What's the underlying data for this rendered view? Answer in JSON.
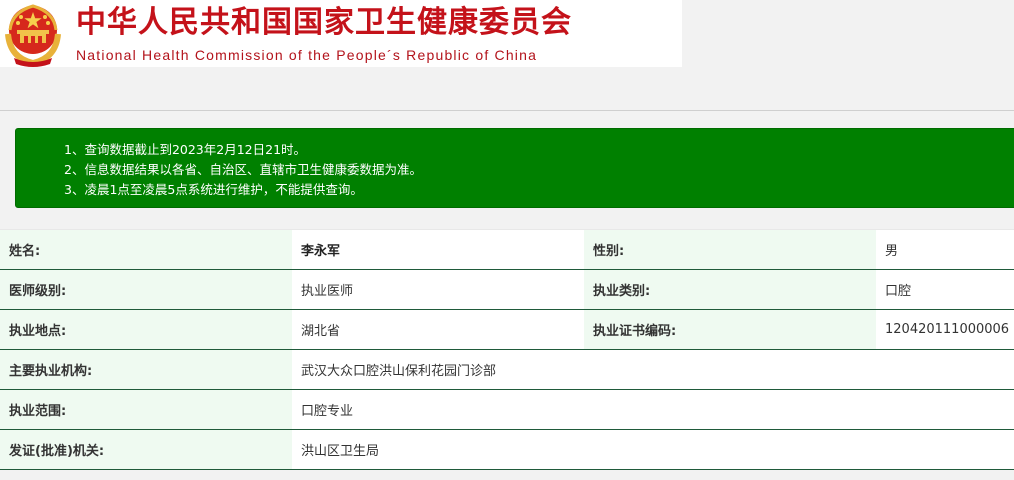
{
  "header": {
    "title_cn": "中华人民共和国国家卫生健康委员会",
    "title_en": "National Health Commission of the People´s Republic of China",
    "emblem_icon": "national-emblem-icon",
    "title_color": "#c4121a"
  },
  "notice": {
    "background": "#008000",
    "lines": [
      "1、查询数据截止到2023年2月12日21时。",
      "2、信息数据结果以各省、自治区、直辖市卫生健康委数据为准。",
      "3、凌晨1点至凌晨5点系统进行维护，不能提供查询。"
    ]
  },
  "record": {
    "name_label": "姓名:",
    "name_value": "李永军",
    "gender_label": "性别:",
    "gender_value": "男",
    "level_label": "医师级别:",
    "level_value": "执业医师",
    "category_label": "执业类别:",
    "category_value": "口腔",
    "location_label": "执业地点:",
    "location_value": "湖北省",
    "cert_label": "执业证书编码:",
    "cert_value": "120420111000006",
    "org_label": "主要执业机构:",
    "org_value": "武汉大众口腔洪山保利花园门诊部",
    "scope_label": "执业范围:",
    "scope_value": "口腔专业",
    "issuer_label": "发证(批准)机关:",
    "issuer_value": "洪山区卫生局"
  }
}
